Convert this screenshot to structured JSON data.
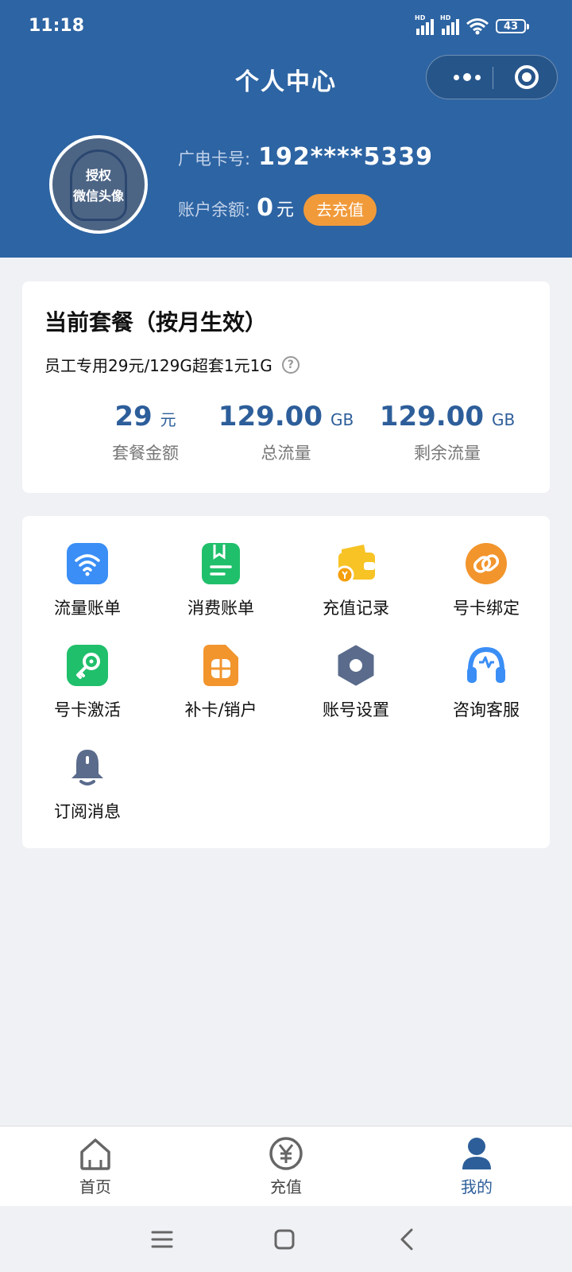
{
  "status_bar": {
    "time": "11:18",
    "battery": "43",
    "hd": "HD"
  },
  "nav": {
    "title": "个人中心"
  },
  "profile": {
    "avatar_text": [
      "授权",
      "微信头像"
    ],
    "card_label": "广电卡号:",
    "card_number": "192****5339",
    "balance_label": "账户余额:",
    "balance_value": "0",
    "balance_unit": "元",
    "recharge_button": "去充值"
  },
  "plan": {
    "title": "当前套餐（按月生效）",
    "name": "员工专用29元/129G超套1元1G",
    "help_symbol": "?",
    "stats": [
      {
        "value": "29",
        "unit": "元",
        "label": "套餐金额"
      },
      {
        "value": "129.00",
        "unit": "GB",
        "label": "总流量"
      },
      {
        "value": "129.00",
        "unit": "GB",
        "label": "剩余流量"
      }
    ]
  },
  "menu": [
    {
      "label": "流量账单",
      "icon": "wifi-icon",
      "color": "#3a8ef5"
    },
    {
      "label": "消费账单",
      "icon": "bookmark-doc-icon",
      "color": "#20bf6b"
    },
    {
      "label": "充值记录",
      "icon": "wallet-coin-icon",
      "color": "#f7c325"
    },
    {
      "label": "号卡绑定",
      "icon": "link-icon",
      "color": "#f2952d"
    },
    {
      "label": "号卡激活",
      "icon": "key-icon",
      "color": "#20bf6b"
    },
    {
      "label": "补卡/销户",
      "icon": "sim-card-icon",
      "color": "#f2952d"
    },
    {
      "label": "账号设置",
      "icon": "hexagon-settings-icon",
      "color": "#5a6b8c"
    },
    {
      "label": "咨询客服",
      "icon": "headset-icon",
      "color": "#3a8ef5"
    },
    {
      "label": "订阅消息",
      "icon": "bell-icon",
      "color": "#5a6b8c"
    }
  ],
  "tabbar": [
    {
      "label": "首页",
      "icon": "home-icon"
    },
    {
      "label": "充值",
      "icon": "yuan-coin-icon"
    },
    {
      "label": "我的",
      "icon": "user-icon"
    }
  ],
  "colors": {
    "header": "#2d64a3",
    "accent": "#2d5e9a",
    "recharge": "#f19a3a"
  }
}
